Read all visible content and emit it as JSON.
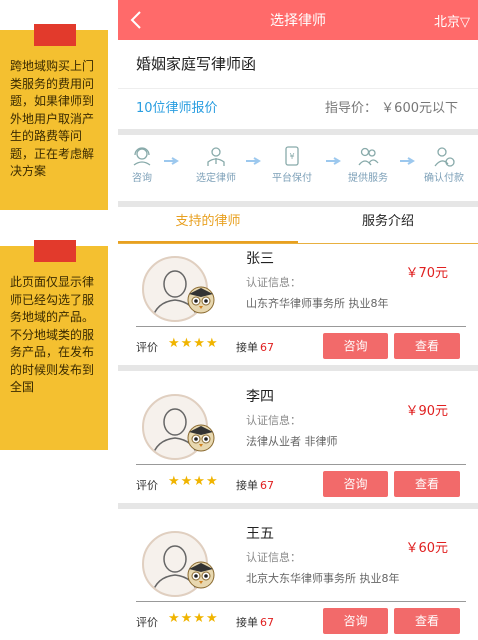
{
  "notes": [
    {
      "text": "跨地域购买上门类服务的费用问题，如果律师到外地用户取消产生的路费等问题，正在考虑解决方案"
    },
    {
      "text": "此页面仅显示律师已经勾选了服务地域的产品。\n不分地域类的服务产品，在发布的时候则发布到全国"
    }
  ],
  "header": {
    "title": "选择律师",
    "city": "北京▽",
    "back_icon": "chevron-left-icon"
  },
  "service": {
    "title": "婚姻家庭写律师函"
  },
  "quote": {
    "count_label": "10位律师报价",
    "guide_label": "指导价：",
    "guide_price": "￥600元以下"
  },
  "steps": [
    {
      "label": "咨询",
      "icon": "headset-icon"
    },
    {
      "label": "选定律师",
      "icon": "lawyer-icon"
    },
    {
      "label": "平台保付",
      "icon": "payment-icon"
    },
    {
      "label": "提供服务",
      "icon": "service-icon"
    },
    {
      "label": "确认付款",
      "icon": "user-pay-icon"
    }
  ],
  "tabs": [
    {
      "label": "支持的律师",
      "active": true
    },
    {
      "label": "服务介绍",
      "active": false
    }
  ],
  "lawyers": [
    {
      "name": "张三",
      "cert_label": "认证信息：",
      "cert_value": "山东齐华律师事务所  执业8年",
      "price": "￥70元",
      "rating_label": "评价",
      "stars": "★★★★",
      "orders_label": "接单",
      "orders": "67",
      "consult_label": "咨询",
      "view_label": "查看"
    },
    {
      "name": "李四",
      "cert_label": "认证信息：",
      "cert_value": "法律从业者  非律师",
      "price": "￥90元",
      "rating_label": "评价",
      "stars": "★★★★",
      "orders_label": "接单",
      "orders": "67",
      "consult_label": "咨询",
      "view_label": "查看"
    },
    {
      "name": "王五",
      "cert_label": "认证信息：",
      "cert_value": "北京大东华律师事务所  执业8年",
      "price": "￥60元",
      "rating_label": "评价",
      "stars": "★★★★",
      "orders_label": "接单",
      "orders": "67",
      "consult_label": "咨询",
      "view_label": "查看"
    }
  ],
  "colors": {
    "header": "#ff6a6a",
    "accent": "#e8a020",
    "link": "#2a9ee0",
    "price": "#e02020",
    "button": "#f26a6a",
    "note": "#f4c030"
  }
}
